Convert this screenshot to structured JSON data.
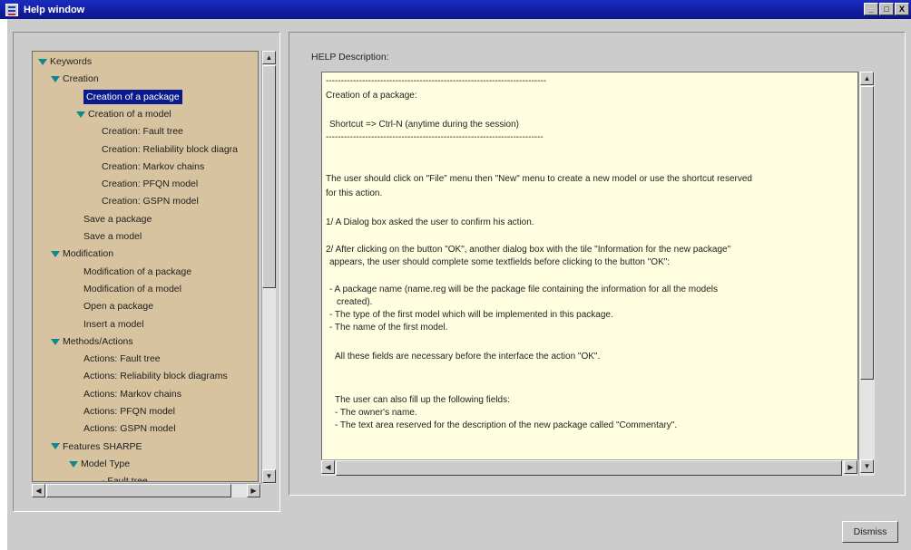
{
  "window": {
    "title": "Help window",
    "controls": [
      "_",
      "□",
      "X"
    ]
  },
  "tree": {
    "items": [
      {
        "label": "Keywords",
        "expanded": true,
        "selected": false
      },
      {
        "label": "Creation",
        "expanded": true,
        "selected": false
      },
      {
        "label": "Creation of a package",
        "expanded": false,
        "selected": true
      },
      {
        "label": "Creation of a model",
        "expanded": true,
        "selected": false
      },
      {
        "label": "Creation: Fault tree",
        "expanded": false,
        "selected": false
      },
      {
        "label": "Creation: Reliability block diagra",
        "expanded": false,
        "selected": false
      },
      {
        "label": "Creation: Markov chains",
        "expanded": false,
        "selected": false
      },
      {
        "label": "Creation: PFQN model",
        "expanded": false,
        "selected": false
      },
      {
        "label": "Creation: GSPN model",
        "expanded": false,
        "selected": false
      },
      {
        "label": "Save a package",
        "expanded": false,
        "selected": false
      },
      {
        "label": "Save a model",
        "expanded": false,
        "selected": false
      },
      {
        "label": "Modification",
        "expanded": true,
        "selected": false
      },
      {
        "label": "Modification of a package",
        "expanded": false,
        "selected": false
      },
      {
        "label": "Modification of a model",
        "expanded": false,
        "selected": false
      },
      {
        "label": "Open a package",
        "expanded": false,
        "selected": false
      },
      {
        "label": "Insert a model",
        "expanded": false,
        "selected": false
      },
      {
        "label": "Methods/Actions",
        "expanded": true,
        "selected": false
      },
      {
        "label": "Actions: Fault tree",
        "expanded": false,
        "selected": false
      },
      {
        "label": "Actions: Reliability block diagrams",
        "expanded": false,
        "selected": false
      },
      {
        "label": "Actions: Markov chains",
        "expanded": false,
        "selected": false
      },
      {
        "label": "Actions: PFQN model",
        "expanded": false,
        "selected": false
      },
      {
        "label": "Actions: GSPN model",
        "expanded": false,
        "selected": false
      },
      {
        "label": "Features SHARPE",
        "expanded": true,
        "selected": false
      },
      {
        "label": "Model Type",
        "expanded": true,
        "selected": false
      },
      {
        "label": "- Fault tree",
        "expanded": false,
        "selected": false
      }
    ]
  },
  "help": {
    "label": "HELP Description:",
    "lines": [
      "-------------------------------------------------------------------------",
      "Creation of a package:",
      "",
      "Shortcut => Ctrl-N (anytime during the session)",
      "------------------------------------------------------------------------",
      "",
      "",
      "The user should click on \"File\" menu then \"New\" menu to create a new model or use the shortcut reserved",
      "for this action.",
      "",
      "1/ A Dialog box asked the user to confirm his action.",
      "",
      "2/ After clicking on the button \"OK\", another dialog box with the tile \"Information for the new package\"",
      "appears, the user should complete some textfields before clicking to the button \"OK\":",
      "",
      "- A package name (name.reg will be the package file containing the information for all the models",
      "created).",
      "- The type of the first model which will be implemented in this package.",
      "- The name of the first model.",
      "",
      "All these fields are necessary before the interface the action \"OK\".",
      "",
      "",
      "The user can also fill up the following fields:",
      "- The owner's name.",
      "- The text area reserved for the description of the new package called \"Commentary\"."
    ]
  },
  "buttons": {
    "dismiss": "Dismiss"
  },
  "colors": {
    "title_bar": "#0d1aa0",
    "tree_background": "#d7c3a0",
    "selection": "#0a1a8c",
    "text_area_background": "#fffee0",
    "tree_arrow": "#0f8a8a"
  }
}
